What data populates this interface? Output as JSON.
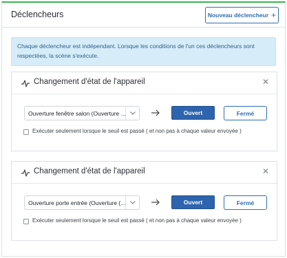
{
  "header": {
    "title": "Déclencheurs",
    "new_trigger_label": "Nouveau déclencheur"
  },
  "info": {
    "line1": "Chaque déclencheur est indépendant. Lorsque les conditions de l'un ces déclencheurs sont",
    "line2": "respectées, la scène s'exécute."
  },
  "triggers": [
    {
      "title": "Changement d'état de l'appareil",
      "device": "Ouverture fenêtre salon (Ouverture ...",
      "open_label": "Ouvert",
      "closed_label": "Fermé",
      "threshold_label": "Exécuter seulement lorsque le seuil est passé ( et non pas à chaque valeur envoyée )"
    },
    {
      "title": "Changement d'état de l'appareil",
      "device": "Ouverture porte entrée (Ouverture (...",
      "open_label": "Ouvert",
      "closed_label": "Fermé",
      "threshold_label": "Exécuter seulement lorsque le seuil est passé ( et non pas à chaque valeur envoyée )"
    }
  ],
  "colors": {
    "accent": "#2e6db4",
    "primary_button": "#2e64ad",
    "info_background": "#d6ecf9",
    "panel_top_border": "#3ab54a"
  },
  "icons": {
    "add": "plus-icon",
    "card": "activity-pulse-icon",
    "remove": "close-icon",
    "dropdown": "chevron-down-icon",
    "transition": "arrow-right-icon"
  }
}
